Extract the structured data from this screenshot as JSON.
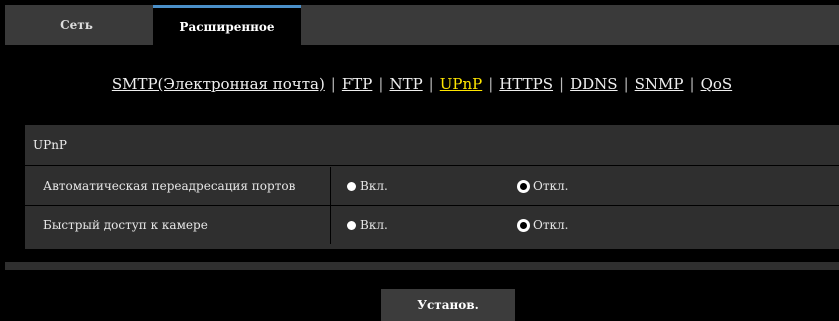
{
  "tabs": [
    {
      "label": "Сеть",
      "active": false
    },
    {
      "label": "Расширенное",
      "active": true
    }
  ],
  "subnav": [
    {
      "label": "SMTP(Электронная почта)",
      "active": false
    },
    {
      "label": "FTP",
      "active": false
    },
    {
      "label": "NTP",
      "active": false
    },
    {
      "label": "UPnP",
      "active": true
    },
    {
      "label": "HTTPS",
      "active": false
    },
    {
      "label": "DDNS",
      "active": false
    },
    {
      "label": "SNMP",
      "active": false
    },
    {
      "label": "QoS",
      "active": false
    }
  ],
  "subnav_separator": "|",
  "panel": {
    "title": "UPnP",
    "rows": [
      {
        "label": "Автоматическая переадресация портов",
        "on_label": "Вкл.",
        "off_label": "Откл.",
        "selected": "off"
      },
      {
        "label": "Быстрый доступ к камере",
        "on_label": "Вкл.",
        "off_label": "Откл.",
        "selected": "off"
      }
    ]
  },
  "submit_label": "Установ.",
  "colors": {
    "background": "#000000",
    "panel": "#2f2f2f",
    "active_link": "#ffe600",
    "active_tab_accent": "#4a8fc9"
  }
}
